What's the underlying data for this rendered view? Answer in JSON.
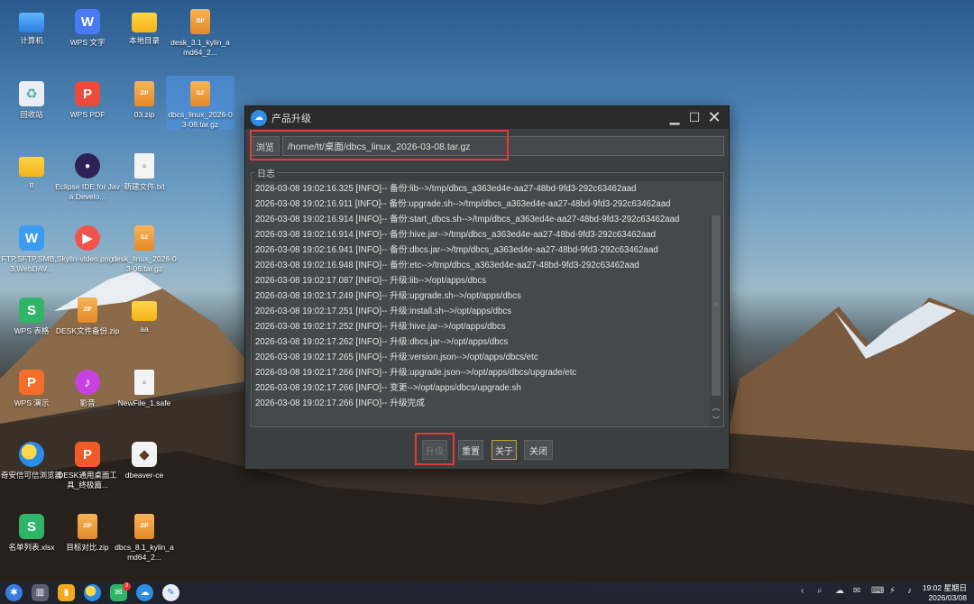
{
  "desktop": {
    "icons": [
      {
        "label": "计算机",
        "glyph": "",
        "kind": "computer"
      },
      {
        "label": "WPS 文字",
        "glyph": "W",
        "kind": "wps-w"
      },
      {
        "label": "本地目录",
        "glyph": "",
        "kind": "folder"
      },
      {
        "label": "desk_3.1_kylin_amd64_2...",
        "glyph": "ZIP",
        "kind": "zip"
      },
      {
        "label": "回收站",
        "glyph": "♻",
        "kind": "trash"
      },
      {
        "label": "WPS PDF",
        "glyph": "P",
        "kind": "wps-p"
      },
      {
        "label": "03.zip",
        "glyph": "ZIP",
        "kind": "zip"
      },
      {
        "label": "dbcs_linux_2026-03-08.tar.gz",
        "glyph": "GZ",
        "kind": "zip"
      },
      {
        "label": "tt",
        "glyph": "",
        "kind": "folder"
      },
      {
        "label": "Eclipse IDE for Java Develo...",
        "glyph": "●",
        "kind": "eclipse"
      },
      {
        "label": "新建文件.txt",
        "glyph": "≡",
        "kind": "txt"
      },
      {
        "label": "FTP,SFTP,SMB,S3,WebDAV...",
        "glyph": "W",
        "kind": "ftp"
      },
      {
        "label": "kylin-video.png",
        "glyph": "▶",
        "kind": "video"
      },
      {
        "label": "desk_linux_2026-03-06.tar.gz",
        "glyph": "GZ",
        "kind": "zip"
      },
      {
        "label": "WPS 表格",
        "glyph": "S",
        "kind": "wps-s"
      },
      {
        "label": "DESK文件备份.zip",
        "glyph": "ZIP",
        "kind": "zip"
      },
      {
        "label": "aa",
        "glyph": "",
        "kind": "folder"
      },
      {
        "label": "WPS 演示",
        "glyph": "P",
        "kind": "wps-show"
      },
      {
        "label": "影音",
        "glyph": "♪",
        "kind": "music"
      },
      {
        "label": "NewFile_1.safe",
        "glyph": "≡",
        "kind": "txt"
      },
      {
        "label": "奇安信可信浏览器",
        "glyph": "",
        "kind": "browser"
      },
      {
        "label": "DESK通用桌面工具_终极篇...",
        "glyph": "P",
        "kind": "desk"
      },
      {
        "label": "dbeaver-ce",
        "glyph": "◆",
        "kind": "dbeaver"
      },
      {
        "label": "名单列表.xlsx",
        "glyph": "S",
        "kind": "wps-s"
      },
      {
        "label": "目标对比.zip",
        "glyph": "ZIP",
        "kind": "zip"
      },
      {
        "label": "dbcs_8.1_kylin_amd64_2...",
        "glyph": "ZIP",
        "kind": "zip"
      }
    ]
  },
  "window": {
    "title": "产品升级",
    "browse_label": "浏览",
    "path_value": "/home/tt/桌面/dbcs_linux_2026-03-08.tar.gz",
    "log_title": "日志",
    "log_lines": [
      "2026-03-08 19:02:16.325 [INFO]-- 备份:lib-->/tmp/dbcs_a363ed4e-aa27-48bd-9fd3-292c63462aad",
      "2026-03-08 19:02:16.911 [INFO]-- 备份:upgrade.sh-->/tmp/dbcs_a363ed4e-aa27-48bd-9fd3-292c63462aad",
      "2026-03-08 19:02:16.914 [INFO]-- 备份:start_dbcs.sh-->/tmp/dbcs_a363ed4e-aa27-48bd-9fd3-292c63462aad",
      "2026-03-08 19:02:16.914 [INFO]-- 备份:hive.jar-->/tmp/dbcs_a363ed4e-aa27-48bd-9fd3-292c63462aad",
      "2026-03-08 19:02:16.941 [INFO]-- 备份:dbcs.jar-->/tmp/dbcs_a363ed4e-aa27-48bd-9fd3-292c63462aad",
      "2026-03-08 19:02:16.948 [INFO]-- 备份:etc-->/tmp/dbcs_a363ed4e-aa27-48bd-9fd3-292c63462aad",
      "2026-03-08 19:02:17.087 [INFO]-- 升级:lib-->/opt/apps/dbcs",
      "2026-03-08 19:02:17.249 [INFO]-- 升级:upgrade.sh-->/opt/apps/dbcs",
      "2026-03-08 19:02:17.251 [INFO]-- 升级:install.sh-->/opt/apps/dbcs",
      "2026-03-08 19:02:17.252 [INFO]-- 升级:hive.jar-->/opt/apps/dbcs",
      "2026-03-08 19:02:17.262 [INFO]-- 升级:dbcs.jar-->/opt/apps/dbcs",
      "2026-03-08 19:02:17.265 [INFO]-- 升级:version.json-->/opt/apps/dbcs/etc",
      "2026-03-08 19:02:17.266 [INFO]-- 升级:upgrade.json-->/opt/apps/dbcs/upgrade/etc",
      "2026-03-08 19:02:17.266 [INFO]-- 变更-->/opt/apps/dbcs/upgrade.sh",
      "2026-03-08 19:02:17.266 [INFO]-- 升级完成"
    ],
    "buttons": {
      "upgrade": "升级",
      "reset": "重置",
      "about": "关于",
      "close": "关闭"
    }
  },
  "taskbar": {
    "badge_count": "3",
    "time": "19:02 星期日",
    "date": "2026/03/08"
  }
}
